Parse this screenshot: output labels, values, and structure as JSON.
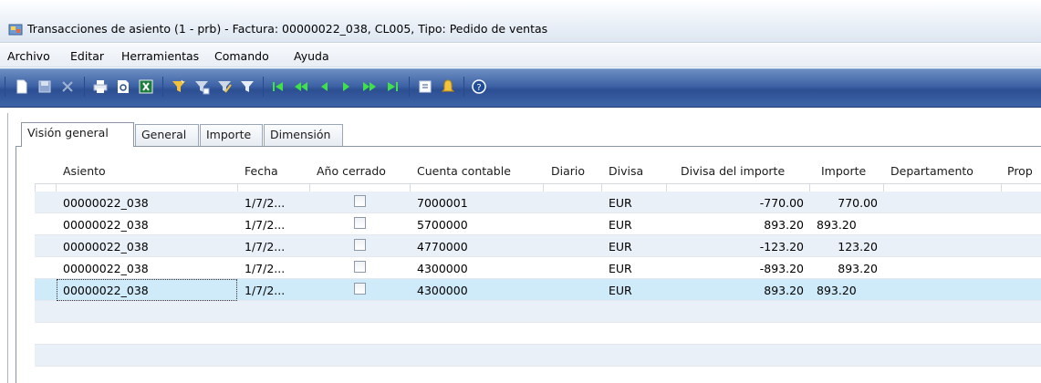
{
  "window": {
    "title": "Transacciones de asiento (1 - prb) - Factura: 00000022_038, CL005, Tipo: Pedido de ventas"
  },
  "menu": [
    "Archivo",
    "Editar",
    "Herramientas",
    "Comando",
    "Ayuda"
  ],
  "toolbar": {
    "icons": [
      "new-icon",
      "save-icon",
      "delete-icon",
      "print-icon",
      "print-preview-icon",
      "export-excel-icon",
      "filter-by-selection-icon",
      "filter-by-grid-icon",
      "advanced-filter-icon",
      "clear-filter-icon",
      "first-record-icon",
      "previous-page-icon",
      "previous-record-icon",
      "next-record-icon",
      "next-page-icon",
      "last-record-icon",
      "document-handling-icon",
      "alert-icon",
      "help-icon"
    ]
  },
  "tabs": [
    "Visión general",
    "General",
    "Importe",
    "Dimensión"
  ],
  "active_tab": "Visión general",
  "grid": {
    "columns": [
      "Asiento",
      "Fecha",
      "Año cerrado",
      "Cuenta contable",
      "Diario",
      "Divisa",
      "Divisa del importe",
      "Importe",
      "Departamento",
      "Prop"
    ],
    "rows": [
      {
        "asiento": "00000022_038",
        "fecha": "1/7/2...",
        "cerrado": false,
        "cuenta": "7000001",
        "diario": "",
        "divisa": "EUR",
        "divisa_importe": "-770.00",
        "importe": "770.00",
        "departamento": ""
      },
      {
        "asiento": "00000022_038",
        "fecha": "1/7/2...",
        "cerrado": false,
        "cuenta": "5700000",
        "diario": "",
        "divisa": "EUR",
        "divisa_importe": "893.20",
        "importe": "893.20",
        "departamento": ""
      },
      {
        "asiento": "00000022_038",
        "fecha": "1/7/2...",
        "cerrado": false,
        "cuenta": "4770000",
        "diario": "",
        "divisa": "EUR",
        "divisa_importe": "-123.20",
        "importe": "123.20",
        "departamento": ""
      },
      {
        "asiento": "00000022_038",
        "fecha": "1/7/2...",
        "cerrado": false,
        "cuenta": "4300000",
        "diario": "",
        "divisa": "EUR",
        "divisa_importe": "-893.20",
        "importe": "893.20",
        "departamento": ""
      },
      {
        "asiento": "00000022_038",
        "fecha": "1/7/2...",
        "cerrado": false,
        "cuenta": "4300000",
        "diario": "",
        "divisa": "EUR",
        "divisa_importe": "893.20",
        "importe": "893.20",
        "departamento": ""
      }
    ],
    "selected_row": 4
  },
  "colors": {
    "toolbar": "#3d62a5",
    "row_alt": "#eaf0f8",
    "row_selected": "#cfeaf8"
  }
}
